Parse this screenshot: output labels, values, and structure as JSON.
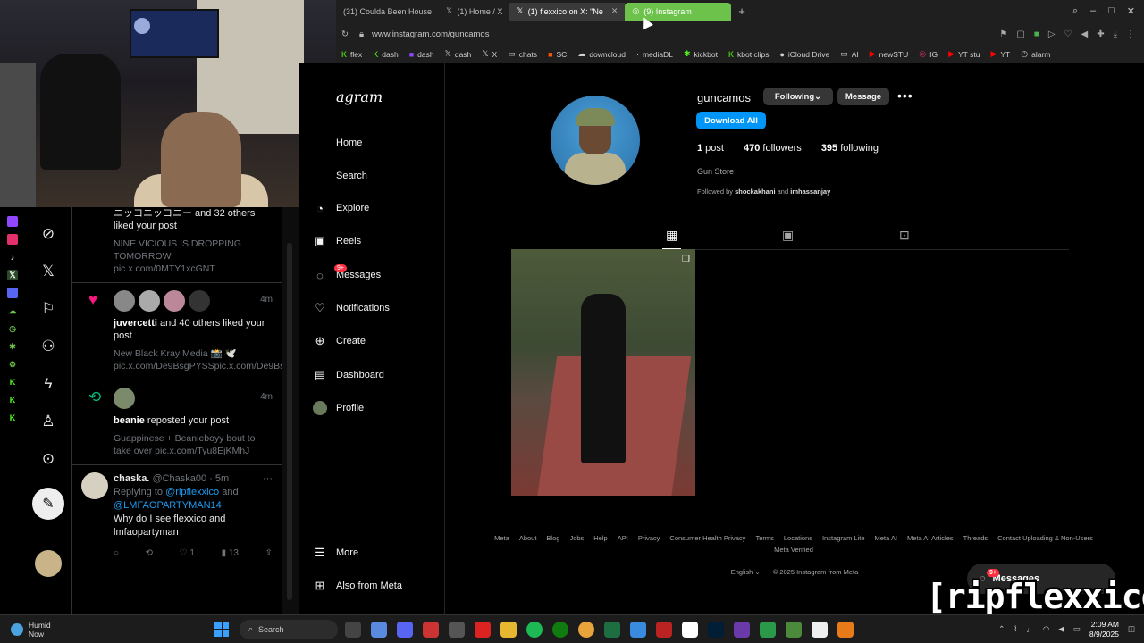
{
  "browser": {
    "tabs": [
      {
        "label": "(31) Coulda Been House",
        "icon": "youtube-icon"
      },
      {
        "label": "(1) Home / X",
        "icon": "x-icon"
      },
      {
        "label": "(1) flexxico on X: \"Ne",
        "icon": "x-icon"
      },
      {
        "label": "(9) Instagram",
        "icon": "instagram-icon"
      }
    ],
    "url": "www.instagram.com/guncamos",
    "bookmarks": [
      {
        "label": "flex",
        "icon": "kick-icon"
      },
      {
        "label": "dash",
        "icon": "kick-icon"
      },
      {
        "label": "dash",
        "icon": "twitch-icon"
      },
      {
        "label": "dash",
        "icon": "x-icon"
      },
      {
        "label": "X",
        "icon": "x-icon"
      },
      {
        "label": "chats",
        "icon": "folder-icon"
      },
      {
        "label": "SC",
        "icon": "sc-icon"
      },
      {
        "label": "downcloud",
        "icon": "cloud-icon"
      },
      {
        "label": "mediaDL",
        "icon": "dot-icon"
      },
      {
        "label": "kickbot",
        "icon": "bot-icon"
      },
      {
        "label": "kbot clips",
        "icon": "kick-icon"
      },
      {
        "label": "iCloud Drive",
        "icon": "cloud-icon"
      },
      {
        "label": "AI",
        "icon": "folder-icon"
      },
      {
        "label": "newSTU",
        "icon": "youtube-icon"
      },
      {
        "label": "IG",
        "icon": "instagram-icon"
      },
      {
        "label": "YT stu",
        "icon": "youtube-icon"
      },
      {
        "label": "YT",
        "icon": "youtube-icon"
      },
      {
        "label": "alarm",
        "icon": "alarm-icon"
      }
    ]
  },
  "x_feed": {
    "n1": {
      "text": "ニッコニッコニー and 32 others liked your post",
      "quote": "NINE VICIOUS IS DROPPING TOMORROW pic.x.com/0MTY1xcGNT"
    },
    "n2": {
      "time": "4m",
      "user": "juvercetti",
      "text": " and 40 others liked your post",
      "quote": "New Black Kray Media 📸 🕊️ pic.x.com/De9BsgPYSSpic.x.com/De9BsgPYSS"
    },
    "n3": {
      "time": "4m",
      "user": "beanie",
      "text": " reposted your post",
      "quote": "Guappinese + Beanieboyy bout to take over pic.x.com/Tyu8EjKMhJ"
    },
    "reply": {
      "name": "chaska.",
      "handle": "@Chaska00 · 5m",
      "replying": "Replying to",
      "to1": "@ripflexxico",
      "and": " and",
      "to2": "@LMFAOPARTYMAN14",
      "body": "Why do I see flexxico and lmfaopartyman",
      "likes": "1",
      "views": "13"
    }
  },
  "ig_nav": {
    "logo": "agram",
    "items": [
      "Home",
      "Search",
      "Explore",
      "Reels",
      "Messages",
      "Notifications",
      "Create",
      "Dashboard",
      "Profile"
    ],
    "messages_badge": "9+",
    "more": "More",
    "also": "Also from Meta"
  },
  "profile": {
    "username": "guncamos",
    "following_btn": "Following",
    "message_btn": "Message",
    "download_btn": "Download All",
    "posts_num": "1",
    "posts_label": " post",
    "followers_num": "470",
    "followers_label": " followers",
    "following_num": "395",
    "following_label": " following",
    "bio": "Gun Store",
    "followed_prefix": "Followed by ",
    "followed_1": "shockakhani",
    "followed_and": " and ",
    "followed_2": "imhassanjay"
  },
  "footer": {
    "links": [
      "Meta",
      "About",
      "Blog",
      "Jobs",
      "Help",
      "API",
      "Privacy",
      "Consumer Health Privacy",
      "Terms",
      "Locations",
      "Instagram Lite",
      "Meta AI",
      "Meta AI Articles",
      "Threads",
      "Contact Uploading & Non-Users",
      "Meta Verified"
    ],
    "language": "English",
    "copyright": "© 2025 Instagram from Meta"
  },
  "messages_pill": {
    "label": "Messages",
    "badge": "9+"
  },
  "watermark": "[ripflexxico]",
  "taskbar": {
    "weather_title": "Humid",
    "weather_sub": "Now",
    "search": "Search",
    "time": "2:09 AM",
    "date": "8/9/2025"
  }
}
